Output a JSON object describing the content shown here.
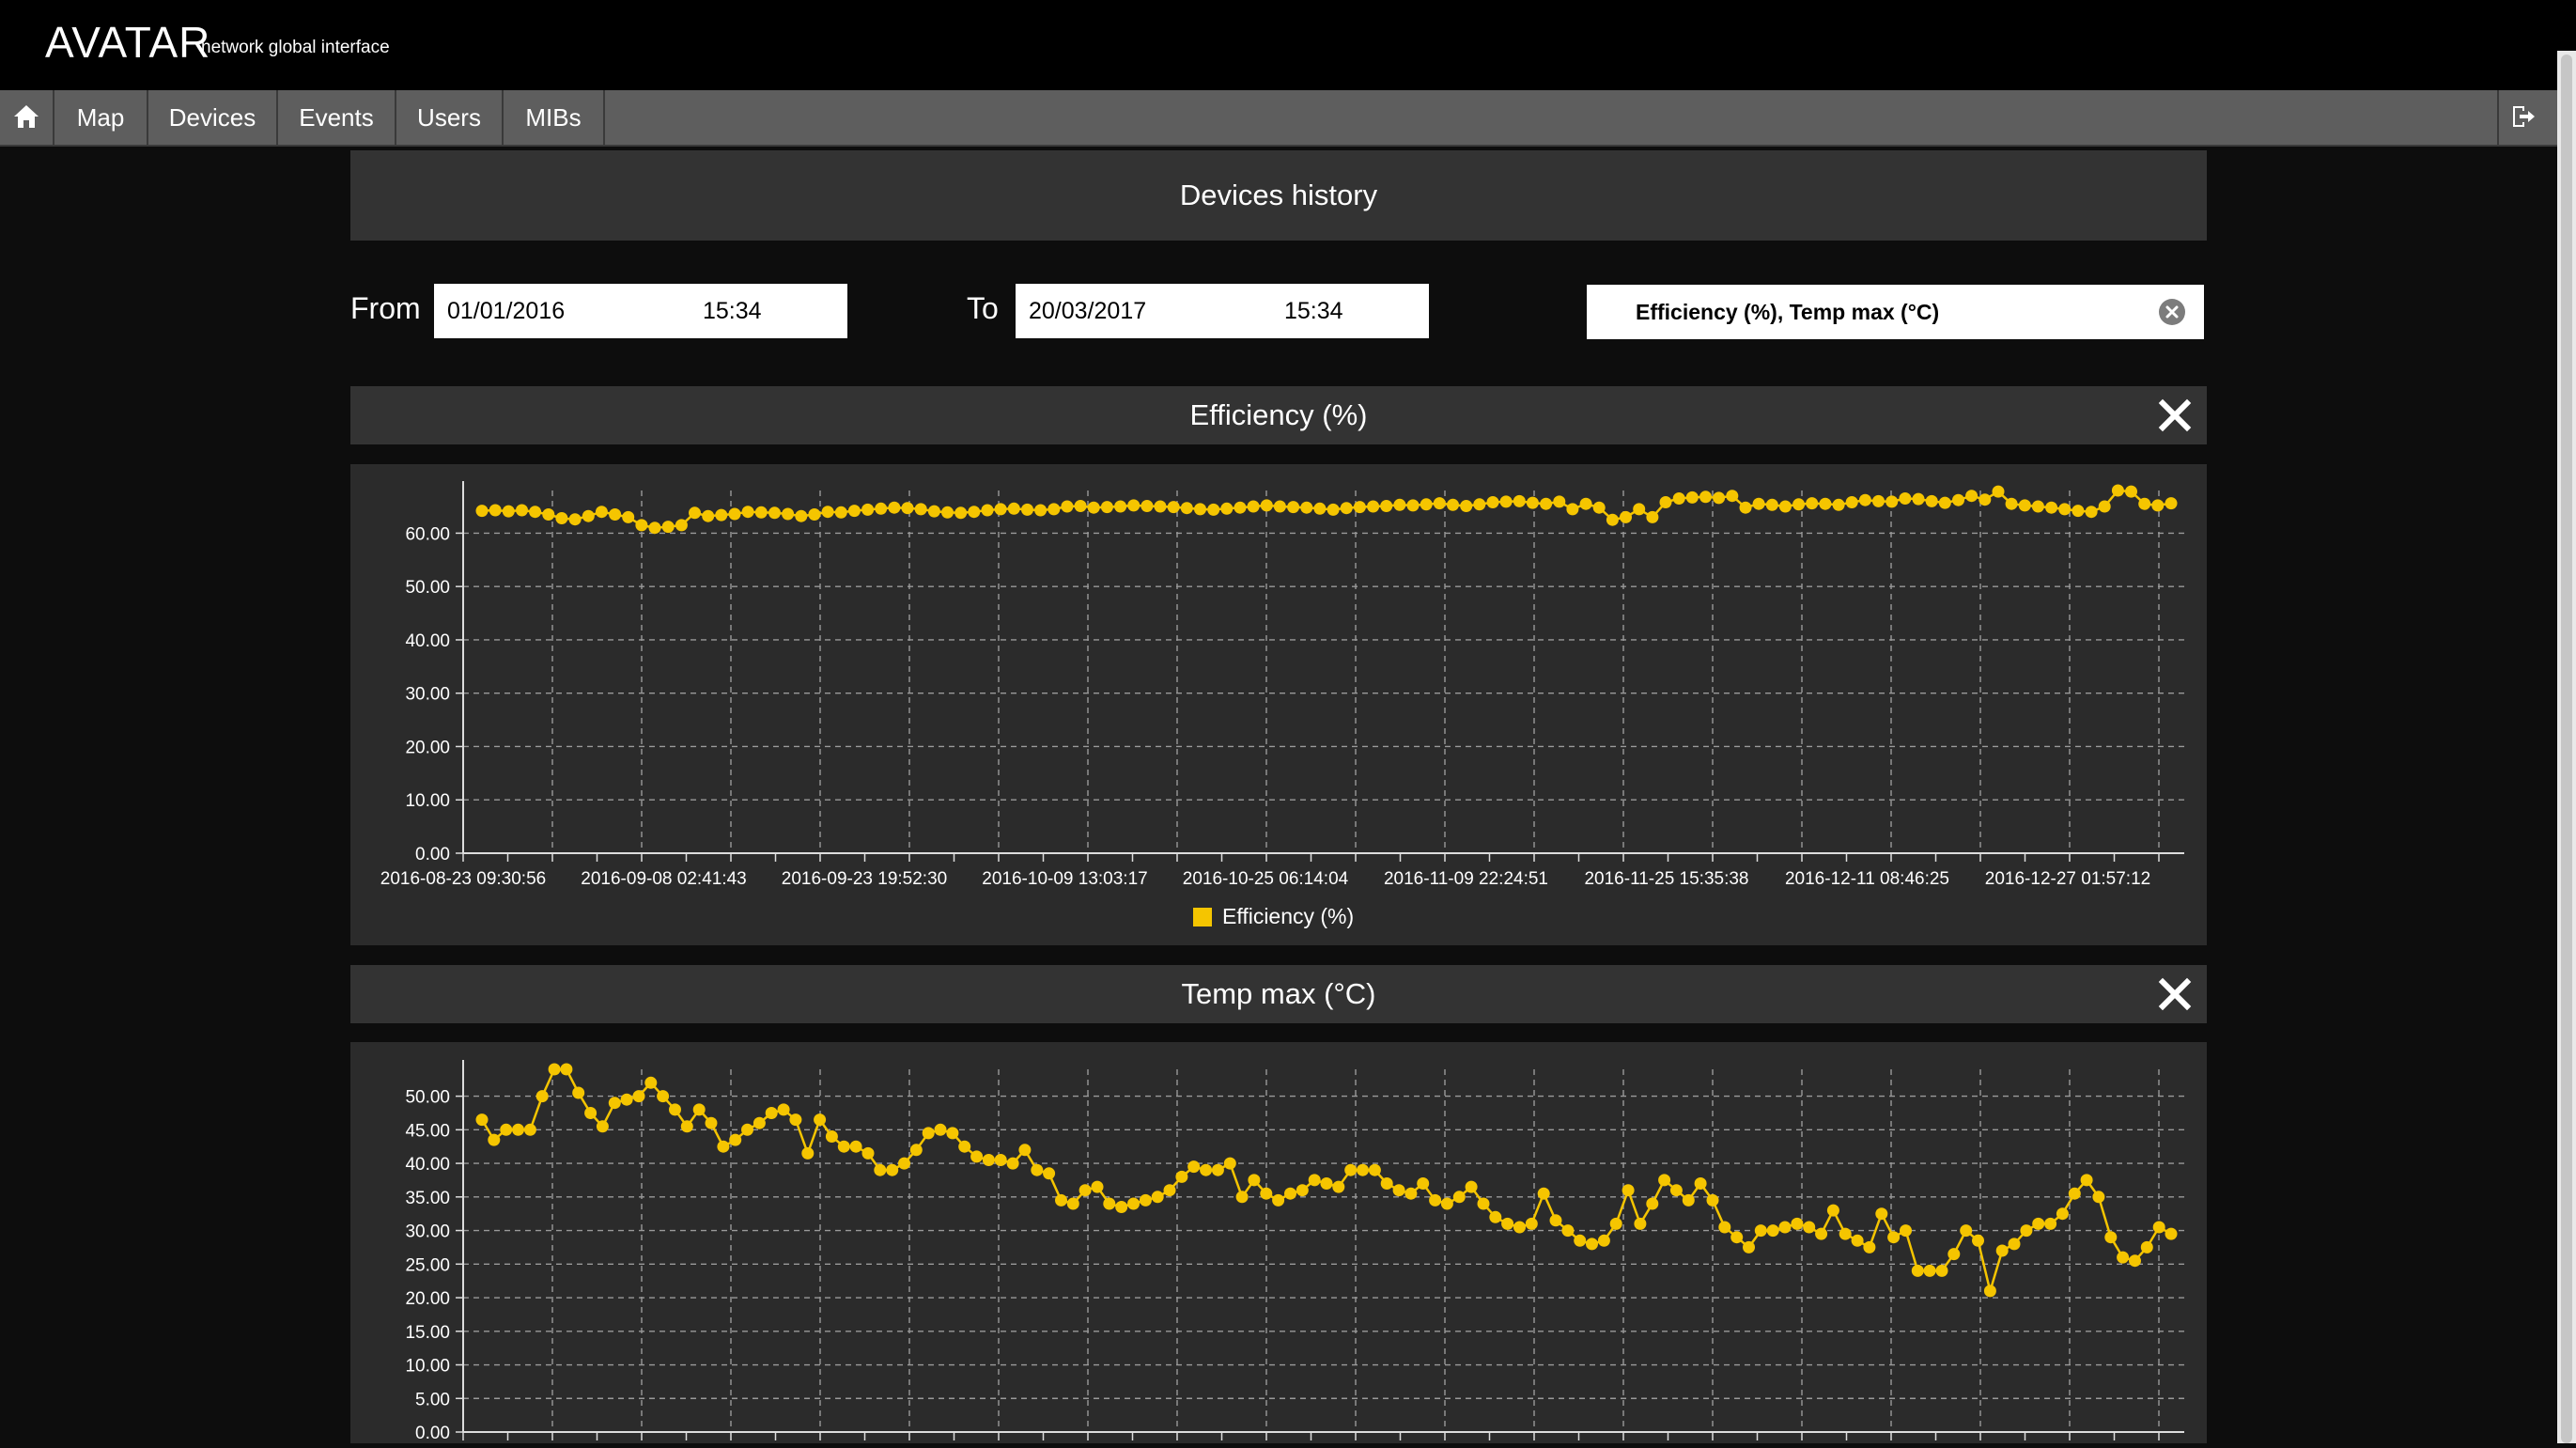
{
  "app": {
    "title": "AVATAR",
    "subtitle": "network global interface"
  },
  "nav": {
    "home_icon": "home-icon",
    "logout_icon": "logout-icon",
    "items": [
      {
        "label": "Map"
      },
      {
        "label": "Devices"
      },
      {
        "label": "Events"
      },
      {
        "label": "Users"
      },
      {
        "label": "MIBs"
      }
    ]
  },
  "page": {
    "title": "Devices history"
  },
  "filters": {
    "from_label": "From",
    "from_date": "01/01/2016",
    "from_time": "15:34",
    "to_label": "To",
    "to_date": "20/03/2017",
    "to_time": "15:34",
    "series_value": "Efficiency (%), Temp max (°C)",
    "clear_icon": "clear-circle-icon"
  },
  "colors": {
    "series": "#f5c500",
    "grid": "#9a9a9a",
    "panel": "#2b2b2b",
    "header": "#333333"
  },
  "panels": {
    "efficiency": {
      "title": "Efficiency (%)",
      "close_icon": "close-x-icon"
    },
    "temp": {
      "title": "Temp max (°C)",
      "close_icon": "close-x-icon"
    }
  },
  "chart_data": [
    {
      "type": "line",
      "title": "Efficiency (%)",
      "x_tick_labels": [
        "2016-08-23 09:30:56",
        "2016-09-08 02:41:43",
        "2016-09-23 19:52:30",
        "2016-10-09 13:03:17",
        "2016-10-25 06:14:04",
        "2016-11-09 22:24:51",
        "2016-11-25 15:35:38",
        "2016-12-11 08:46:25",
        "2016-12-27 01:57:12"
      ],
      "y_tick_labels": [
        "0.00",
        "10.00",
        "20.00",
        "30.00",
        "40.00",
        "50.00",
        "60.00"
      ],
      "ylim": [
        0,
        68
      ],
      "grid": true,
      "legend": "bottom-center",
      "series": [
        {
          "name": "Efficiency (%)",
          "values": [
            64.2,
            64.3,
            64.1,
            64.3,
            64.0,
            63.5,
            62.8,
            62.6,
            63.2,
            64.0,
            63.5,
            63.0,
            61.5,
            61.0,
            61.2,
            61.5,
            63.8,
            63.2,
            63.4,
            63.6,
            64.0,
            63.9,
            63.8,
            63.6,
            63.2,
            63.5,
            64.0,
            63.9,
            64.2,
            64.4,
            64.6,
            64.8,
            64.7,
            64.5,
            64.1,
            63.9,
            63.8,
            64.0,
            64.3,
            64.5,
            64.6,
            64.4,
            64.3,
            64.5,
            65.0,
            65.1,
            64.8,
            64.9,
            65.0,
            65.2,
            65.1,
            65.0,
            64.9,
            64.7,
            64.5,
            64.4,
            64.6,
            64.8,
            65.0,
            65.2,
            65.0,
            64.9,
            64.8,
            64.6,
            64.4,
            64.7,
            64.9,
            65.0,
            65.1,
            65.3,
            65.2,
            65.4,
            65.6,
            65.3,
            65.1,
            65.4,
            65.8,
            65.9,
            66.0,
            65.7,
            65.5,
            65.9,
            64.5,
            65.5,
            64.8,
            62.5,
            63.0,
            64.5,
            63.0,
            65.8,
            66.5,
            66.7,
            66.8,
            66.6,
            67.0,
            64.8,
            65.5,
            65.3,
            65.0,
            65.4,
            65.6,
            65.5,
            65.3,
            65.8,
            66.2,
            66.0,
            65.9,
            66.5,
            66.4,
            66.0,
            65.7,
            66.2,
            67.0,
            66.3,
            67.8,
            65.5,
            65.2,
            65.0,
            64.8,
            64.5,
            64.2,
            64.0,
            65.0,
            68.0,
            67.8,
            65.5,
            65.2,
            65.6
          ]
        }
      ]
    },
    {
      "type": "line",
      "title": "Temp max (°C)",
      "y_tick_labels": [
        "0.00",
        "5.00",
        "10.00",
        "15.00",
        "20.00",
        "25.00",
        "30.00",
        "35.00",
        "40.00",
        "45.00",
        "50.00"
      ],
      "ylim": [
        0,
        54
      ],
      "grid": true,
      "series": [
        {
          "name": "Temp max (°C)",
          "values": [
            46.5,
            43.5,
            45.0,
            45.0,
            45.0,
            50.0,
            54.0,
            54.0,
            50.5,
            47.5,
            45.5,
            49.0,
            49.5,
            50.0,
            52.0,
            50.0,
            48.0,
            45.5,
            48.0,
            46.0,
            42.5,
            43.5,
            45.0,
            46.0,
            47.5,
            48.0,
            46.5,
            41.5,
            46.5,
            44.0,
            42.5,
            42.5,
            41.5,
            39.0,
            39.0,
            40.0,
            42.0,
            44.5,
            45.0,
            44.5,
            42.5,
            41.0,
            40.5,
            40.5,
            40.0,
            42.0,
            39.0,
            38.5,
            34.5,
            34.0,
            36.0,
            36.5,
            34.0,
            33.5,
            34.0,
            34.5,
            35.0,
            36.0,
            38.0,
            39.5,
            39.0,
            39.0,
            40.0,
            35.0,
            37.5,
            35.5,
            34.5,
            35.5,
            36.0,
            37.5,
            37.0,
            36.5,
            39.0,
            39.0,
            39.0,
            37.0,
            36.0,
            35.5,
            37.0,
            34.5,
            34.0,
            35.0,
            36.5,
            34.0,
            32.0,
            31.0,
            30.5,
            31.0,
            35.5,
            31.5,
            30.0,
            28.5,
            28.0,
            28.5,
            31.0,
            36.0,
            31.0,
            34.0,
            37.5,
            36.0,
            34.5,
            37.0,
            34.5,
            30.5,
            29.0,
            27.5,
            30.0,
            30.0,
            30.5,
            31.0,
            30.5,
            29.5,
            33.0,
            29.5,
            28.5,
            27.5,
            32.5,
            29.0,
            30.0,
            24.0,
            24.0,
            24.0,
            26.5,
            30.0,
            28.5,
            21.0,
            27.0,
            28.0,
            30.0,
            31.0,
            31.0,
            32.5,
            35.5,
            37.5,
            35.0,
            29.0,
            26.0,
            25.5,
            27.5,
            30.5,
            29.5
          ]
        }
      ]
    }
  ]
}
